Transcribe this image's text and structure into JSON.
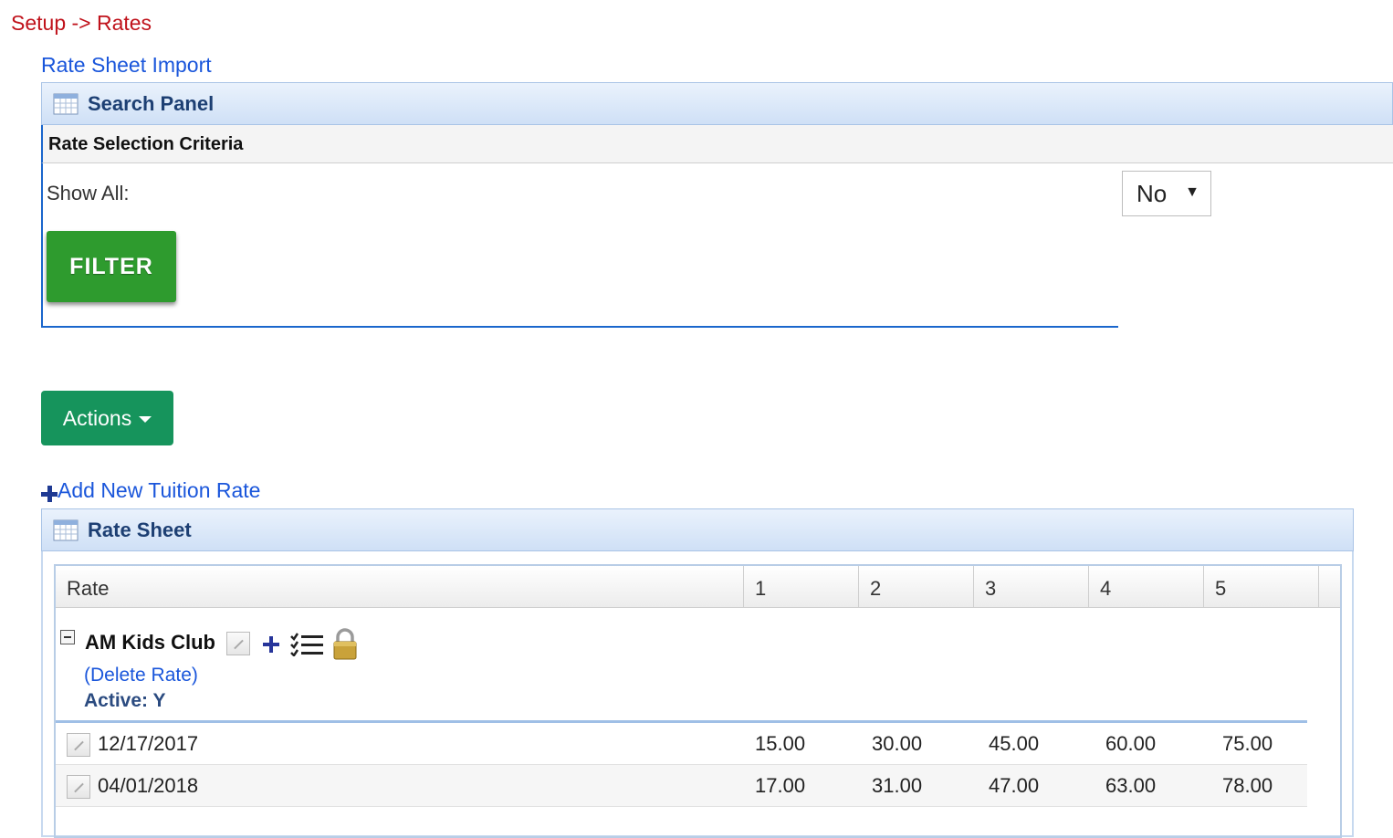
{
  "breadcrumb": "Setup -> Rates",
  "rate_sheet_import_link": "Rate Sheet Import",
  "search_panel": {
    "title": "Search Panel",
    "criteria_title": "Rate Selection Criteria",
    "show_all_label": "Show All:",
    "show_all_value": "No",
    "filter_button": "FILTER"
  },
  "actions_button": "Actions",
  "add_rate_link": "Add New Tuition Rate",
  "rate_sheet": {
    "title": "Rate Sheet",
    "columns": [
      "Rate",
      "1",
      "2",
      "3",
      "4",
      "5"
    ],
    "group": {
      "name": "AM Kids Club",
      "delete_link": "(Delete Rate)",
      "active_label": "Active: Y"
    },
    "rows": [
      {
        "date": "12/17/2017",
        "values": [
          "15.00",
          "30.00",
          "45.00",
          "60.00",
          "75.00"
        ]
      },
      {
        "date": "04/01/2018",
        "values": [
          "17.00",
          "31.00",
          "47.00",
          "63.00",
          "78.00"
        ]
      }
    ]
  },
  "colors": {
    "breadcrumb": "#c0121b",
    "link": "#1a56db",
    "filter_button": "#2e9b2e",
    "actions_button": "#16945c",
    "panel_title": "#1d3f73"
  }
}
